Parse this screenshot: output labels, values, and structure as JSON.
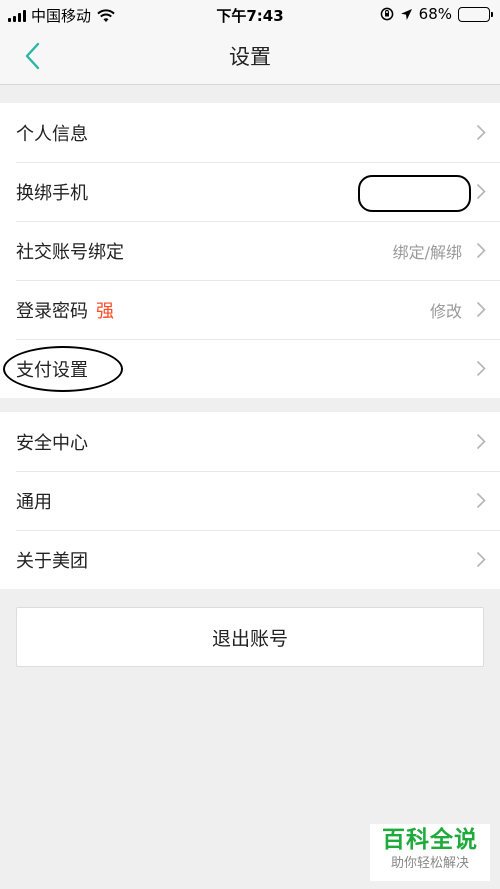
{
  "status_bar": {
    "carrier": "中国移动",
    "time": "下午7:43",
    "battery": "68%",
    "battery_level": 0.68
  },
  "nav": {
    "title": "设置"
  },
  "group1": [
    {
      "label": "个人信息",
      "value": "",
      "badge": ""
    },
    {
      "label": "换绑手机",
      "value": "",
      "badge": ""
    },
    {
      "label": "社交账号绑定",
      "value": "绑定/解绑",
      "badge": ""
    },
    {
      "label": "登录密码",
      "value": "修改",
      "badge": "强"
    },
    {
      "label": "支付设置",
      "value": "",
      "badge": ""
    }
  ],
  "group2": [
    {
      "label": "安全中心"
    },
    {
      "label": "通用"
    },
    {
      "label": "关于美团"
    }
  ],
  "logout_label": "退出账号",
  "watermark": {
    "title": "百科全说",
    "subtitle": "助你轻松解决"
  },
  "colors": {
    "accent": "#2bb5a6",
    "badge": "#ff4a26",
    "watermark": "#1faa3c"
  }
}
